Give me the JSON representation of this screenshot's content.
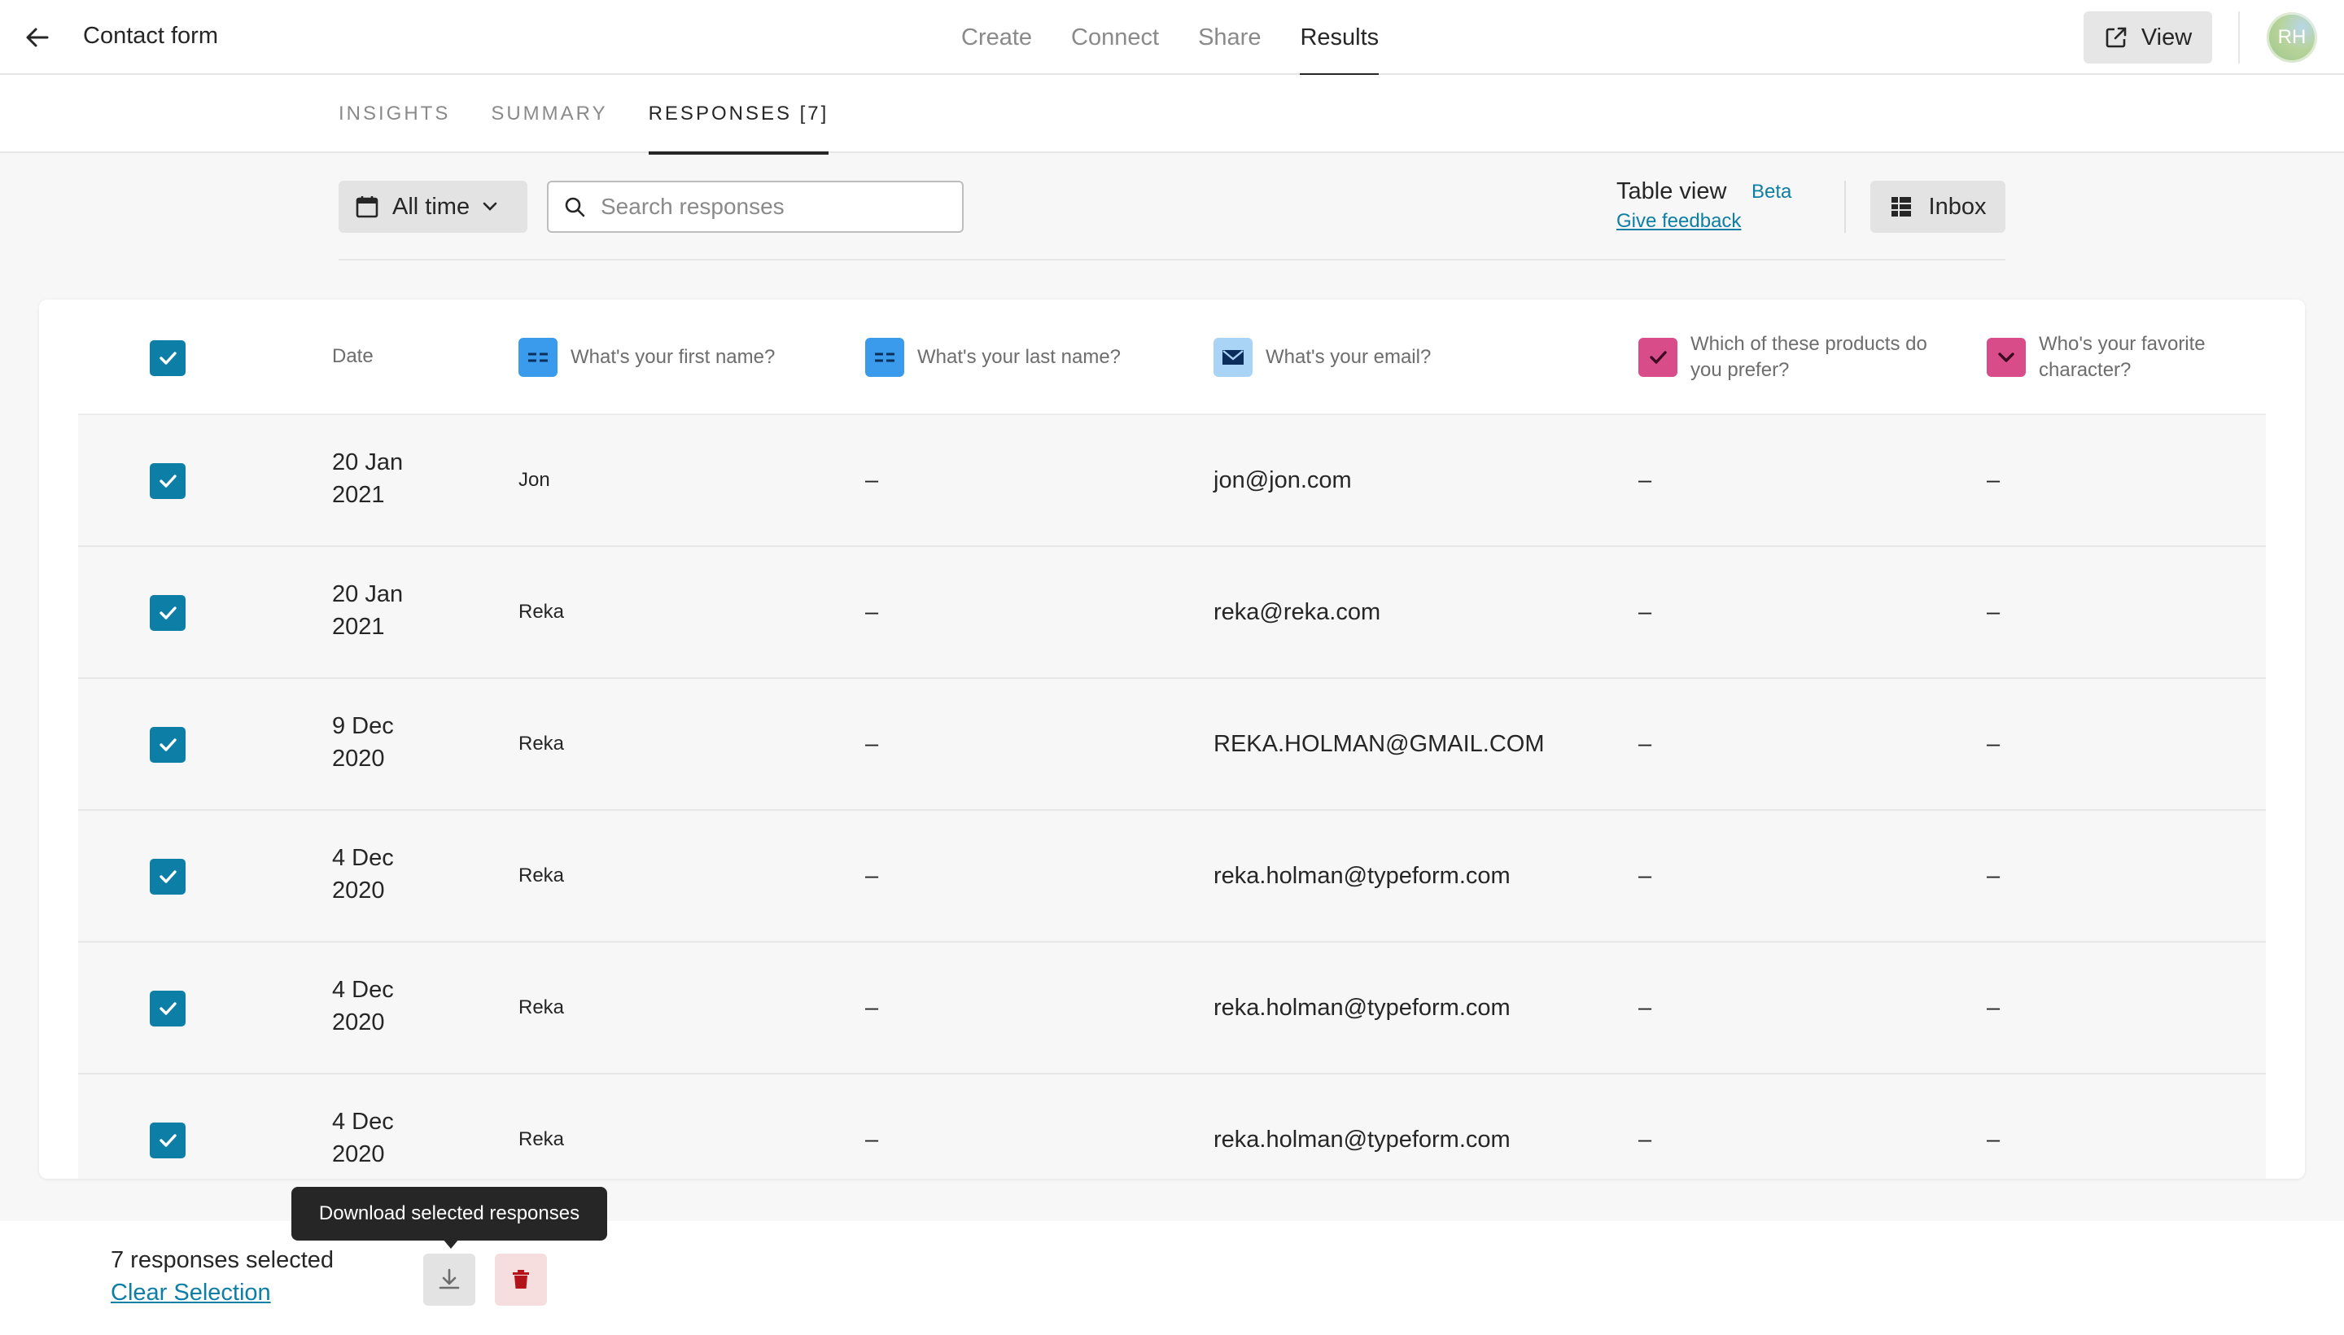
{
  "header": {
    "title": "Contact form",
    "nav": [
      "Create",
      "Connect",
      "Share",
      "Results"
    ],
    "active_nav": "Results",
    "view_label": "View",
    "avatar_initials": "RH"
  },
  "subnav": {
    "tabs": [
      "INSIGHTS",
      "SUMMARY",
      "RESPONSES [7]"
    ],
    "active": "RESPONSES [7]"
  },
  "toolbar": {
    "date_filter": "All time",
    "search_placeholder": "Search responses",
    "table_view_label": "Table view",
    "beta_label": "Beta",
    "feedback_link": "Give feedback",
    "inbox_label": "Inbox"
  },
  "table": {
    "columns": {
      "date": "Date",
      "first_name": "What's your first name?",
      "last_name": "What's your last name?",
      "email": "What's your email?",
      "products": "Which of these products do you prefer?",
      "character": "Who's your favorite character?"
    },
    "rows": [
      {
        "date": "20 Jan 2021",
        "first_name": "Jon",
        "last_name": "–",
        "email": "jon@jon.com",
        "products": "–",
        "character": "–"
      },
      {
        "date": "20 Jan 2021",
        "first_name": "Reka",
        "last_name": "–",
        "email": "reka@reka.com",
        "products": "–",
        "character": "–"
      },
      {
        "date": "9 Dec 2020",
        "first_name": "Reka",
        "last_name": "–",
        "email": "REKA.HOLMAN@GMAIL.COM",
        "products": "–",
        "character": "–"
      },
      {
        "date": "4 Dec 2020",
        "first_name": "Reka",
        "last_name": "–",
        "email": "reka.holman@typeform.com",
        "products": "–",
        "character": "–"
      },
      {
        "date": "4 Dec 2020",
        "first_name": "Reka",
        "last_name": "–",
        "email": "reka.holman@typeform.com",
        "products": "–",
        "character": "–"
      },
      {
        "date": "4 Dec 2020",
        "first_name": "Reka",
        "last_name": "–",
        "email": "reka.holman@typeform.com",
        "products": "–",
        "character": "–"
      }
    ]
  },
  "selection": {
    "count_label": "7 responses selected",
    "clear_label": "Clear Selection",
    "tooltip": "Download selected responses"
  },
  "colors": {
    "accent": "#0d7ea5",
    "text_field_icon": "#3a9bec",
    "email_icon": "#a9d4f5",
    "choice_icon": "#d94c8a",
    "delete_icon": "#b3131b"
  },
  "icons": [
    "arrow-left-icon",
    "external-link-icon",
    "calendar-icon",
    "chevron-down-icon",
    "search-icon",
    "inbox-icon",
    "checkbox-icon",
    "short-text-icon",
    "email-icon",
    "multiple-choice-icon",
    "download-icon",
    "trash-icon"
  ]
}
